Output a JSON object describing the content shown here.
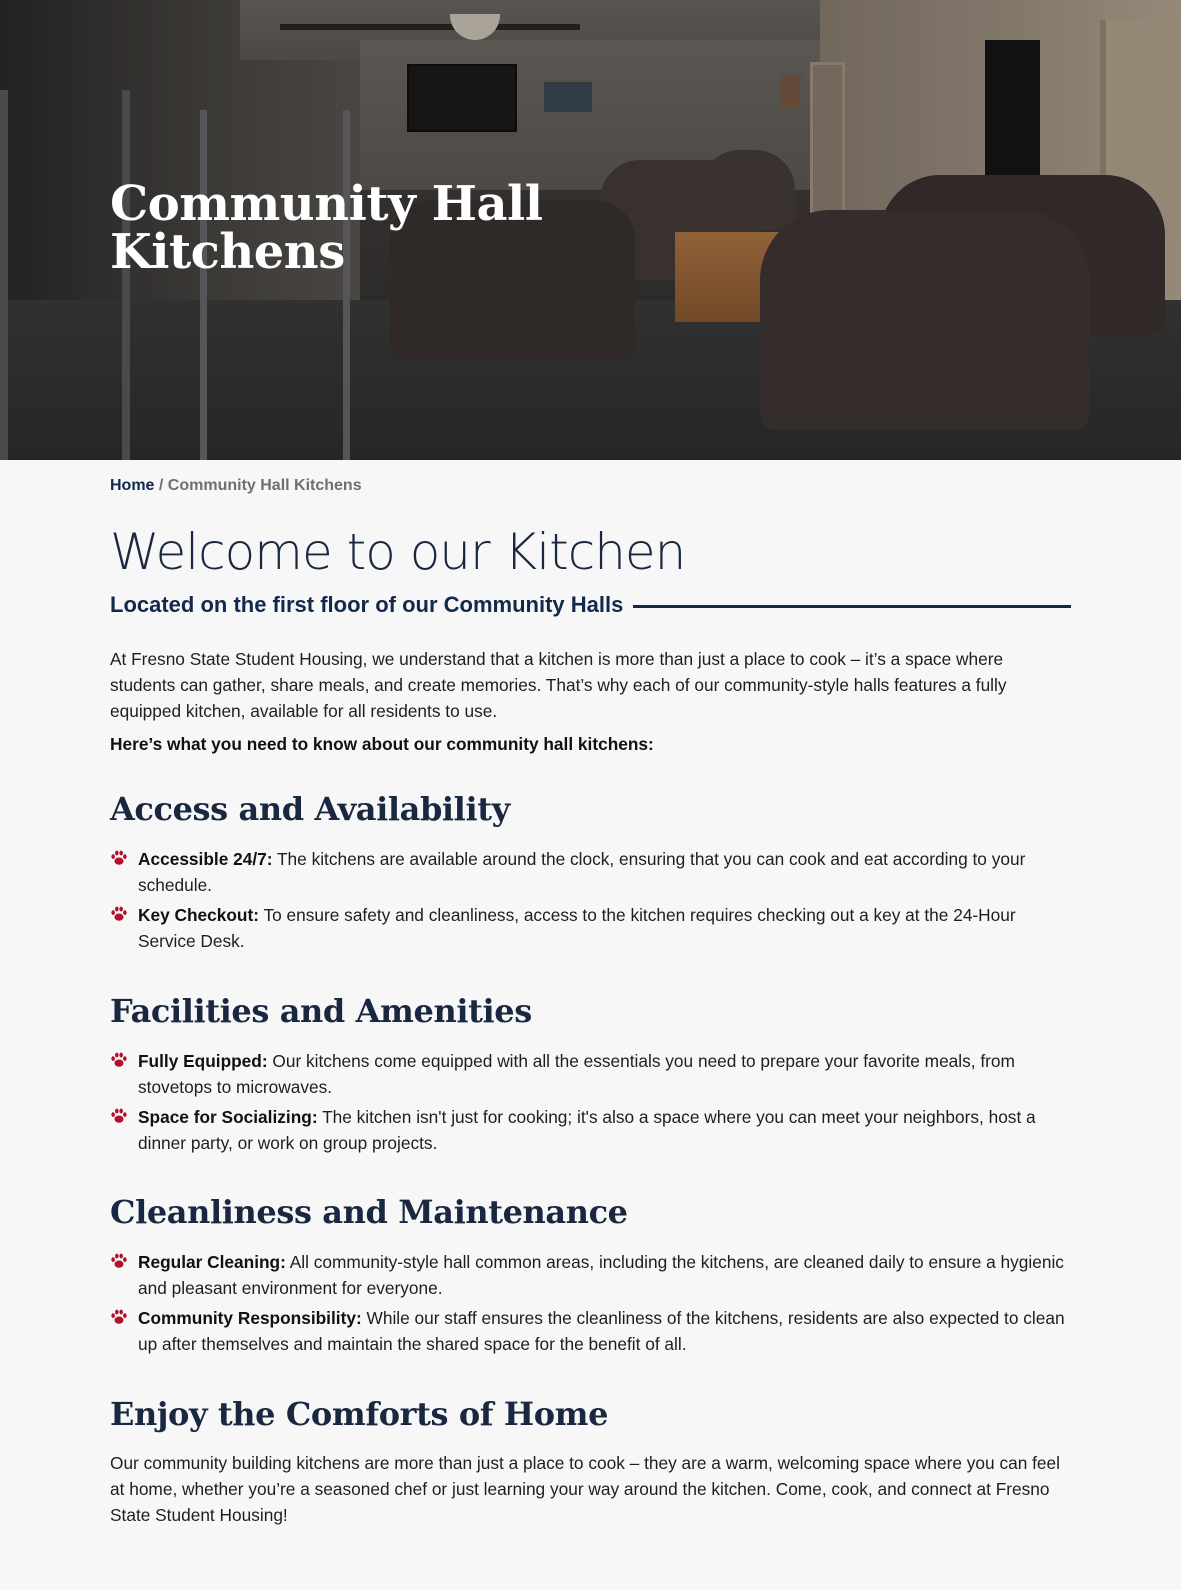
{
  "hero": {
    "title_line1": "Community Hall",
    "title_line2": "Kitchens"
  },
  "breadcrumb": {
    "home": "Home",
    "separator": " / ",
    "current": "Community Hall Kitchens"
  },
  "main": {
    "heading": "Welcome to our Kitchen",
    "subheading": "Located on the first floor of our Community Halls",
    "intro": "At Fresno State Student Housing, we understand that a kitchen is more than just a place to cook – it’s a space where students can gather, share meals, and create memories. That’s why each of our community-style halls features a fully equipped kitchen, available for all residents to use.",
    "lead": "Here’s what you need to know about our community hall kitchens:"
  },
  "sections": [
    {
      "title": "Access and Availability",
      "items": [
        {
          "label": "Accessible 24/7:",
          "text": " The kitchens are available around the clock, ensuring that you can cook and eat according to your schedule."
        },
        {
          "label": "Key Checkout:",
          "text": " To ensure safety and cleanliness, access to the kitchen requires checking out a key at the 24-Hour Service Desk."
        }
      ]
    },
    {
      "title": "Facilities and Amenities",
      "items": [
        {
          "label": "Fully Equipped:",
          "text": " Our kitchens come equipped with all the essentials you need to prepare your favorite meals, from stovetops to microwaves."
        },
        {
          "label": "Space for Socializing:",
          "text": " The kitchen isn't just for cooking; it's also a space where you can meet your neighbors, host a dinner party, or work on group projects."
        }
      ]
    },
    {
      "title": "Cleanliness and Maintenance",
      "items": [
        {
          "label": "Regular Cleaning:",
          "text": " All community-style hall common areas, including the kitchens, are cleaned daily to ensure a hygienic and pleasant environment for everyone."
        },
        {
          "label": "Community Responsibility:",
          "text": " While our staff ensures the cleanliness of the kitchens, residents are also expected to clean up after themselves and maintain the shared space for the benefit of all."
        }
      ]
    },
    {
      "title": "Enjoy the Comforts of Home",
      "paragraph": "Our community building kitchens are more than just a place to cook – they are a warm, welcoming space where you can feel at home, whether you’re a seasoned chef or just learning your way around the kitchen. Come, cook, and connect at Fresno State Student Housing!"
    }
  ],
  "colors": {
    "navy": "#13294b",
    "accent_red": "#b1102b"
  },
  "icons": {
    "bullet": "paw-icon"
  }
}
